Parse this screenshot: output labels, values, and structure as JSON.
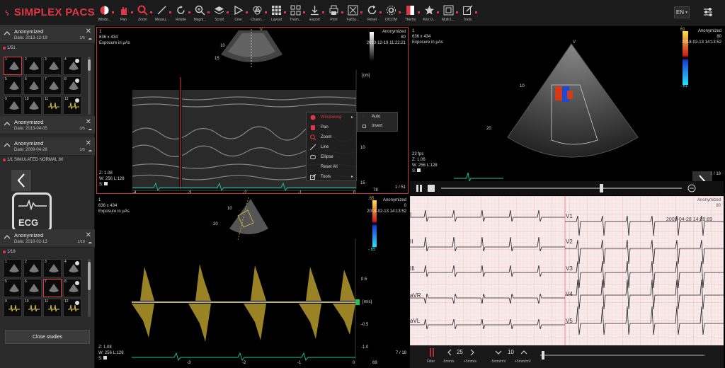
{
  "app": {
    "brand": "SIMPLEX PACS",
    "language": "EN"
  },
  "toolbar": [
    {
      "label": "Windo...",
      "icon": "windowing-icon"
    },
    {
      "label": "Pan",
      "icon": "pan-icon"
    },
    {
      "label": "Zoom",
      "icon": "zoom-icon"
    },
    {
      "label": "Measu...",
      "icon": "measure-icon"
    },
    {
      "label": "Rotate",
      "icon": "rotate-icon"
    },
    {
      "label": "Magni...",
      "icon": "magnifier-icon"
    },
    {
      "label": "Scroll",
      "icon": "scroll-icon"
    },
    {
      "label": "Cine",
      "icon": "cine-icon"
    },
    {
      "label": "Chann...",
      "icon": "channel-icon"
    },
    {
      "label": "Layout",
      "icon": "layout-icon"
    },
    {
      "label": "Thum...",
      "icon": "thumbnails-icon"
    },
    {
      "label": "Export",
      "icon": "export-icon"
    },
    {
      "label": "Print",
      "icon": "print-icon"
    },
    {
      "label": "FullSc...",
      "icon": "fullscreen-icon"
    },
    {
      "label": "Reset",
      "icon": "reset-icon"
    },
    {
      "label": "DICOM",
      "icon": "dicom-icon"
    },
    {
      "label": "Theme",
      "icon": "theme-icon"
    },
    {
      "label": "Key O...",
      "icon": "star-icon"
    },
    {
      "label": "Multi L...",
      "icon": "multi-layout-icon"
    },
    {
      "label": "Tools",
      "icon": "tools-icon"
    }
  ],
  "sidebar": {
    "studies": [
      {
        "name": "Anonymized",
        "date": "Date: 2013-12-19",
        "count": "1/5",
        "series": "1/51"
      },
      {
        "name": "Anonymized",
        "date": "Date: 2013-04-05",
        "count": "3/5"
      },
      {
        "name": "Anonymized",
        "date": "Date: 2009-04-28",
        "count": "1/5",
        "series": "1/1   SIMULATED NORMAL 80"
      },
      {
        "name": "Anonymized",
        "date": "Date: 2018-02-13",
        "count": "1/18",
        "series": "1/18"
      }
    ],
    "thumbs_a": [
      "1",
      "2",
      "3",
      "4",
      "5",
      "6",
      "7",
      "8",
      "9",
      "10",
      "11",
      "12"
    ],
    "thumbs_b": [
      "1",
      "2",
      "3",
      "4",
      "5",
      "6",
      "7",
      "8",
      "9",
      "10",
      "11",
      "12"
    ],
    "ecg_badge": "ECG",
    "close_button": "Close studies"
  },
  "vp1": {
    "tl": [
      "1",
      "636 x 434",
      "Exposure in µAs"
    ],
    "tr": [
      "Anonymized",
      "80",
      "2013-12-19 11:22:21"
    ],
    "bl": [
      "Z: 1.08",
      "W: 256 L:128",
      "S:"
    ],
    "frame": "1 / 51",
    "unit": "[cm]",
    "scale": [
      "5",
      "10",
      "15"
    ],
    "scale_top": [
      "10",
      "15"
    ],
    "time_ticks": [
      "-4",
      "-3",
      "-2",
      "-1",
      "0"
    ],
    "bottom_val": "78",
    "heading": "V"
  },
  "menu": {
    "items": [
      {
        "label": "Windowing",
        "icon": "windowing-icon",
        "active": true,
        "arrow": "▸"
      },
      {
        "label": "Pan",
        "icon": "pan-icon"
      },
      {
        "label": "Zoom",
        "icon": "zoom-icon"
      },
      {
        "label": "Line",
        "icon": "line-icon"
      },
      {
        "label": "Ellipse",
        "icon": "ellipse-icon"
      },
      {
        "label": "Reset All",
        "icon": ""
      },
      {
        "label": "Tools",
        "icon": "tools-icon",
        "arrow": "▸"
      }
    ],
    "submenu": [
      {
        "label": "Auto",
        "checked": false
      },
      {
        "label": "Invert",
        "checked": false
      }
    ]
  },
  "vp2": {
    "tl": [
      "1",
      "636 x 434",
      "Exposure in µAs"
    ],
    "tr": [
      "Anonymized",
      "80",
      "2018-02-13 14:13:52"
    ],
    "bl": [
      "23 fps",
      "Z: 1.06",
      "W: 256 L:128",
      "S:"
    ],
    "scale_top": "61",
    "scale_bot": "-.61",
    "depth": [
      "10",
      "20"
    ],
    "heading": "V",
    "frame": "1 / 18"
  },
  "vp3": {
    "tl": [
      "1",
      "636 x 434",
      "Exposure in µAs"
    ],
    "tr": [
      "Anonymized",
      "0",
      "2018-02-13 14:13:52"
    ],
    "bl": [
      "Z: 1.08",
      "W: 256 L:128",
      "S:"
    ],
    "scale_top": ".65",
    "scale_bot": "-.65",
    "depth": [
      "10",
      "20"
    ],
    "unit": "[m/s]",
    "vel_ticks": [
      "0.5",
      "-0.5",
      "-1.0"
    ],
    "time_ticks": [
      "-3",
      "-2",
      "-1",
      "0"
    ],
    "bottom_val": "69",
    "frame": "7 / 18"
  },
  "vp4": {
    "tr": [
      "Anonymized",
      "80"
    ],
    "timestamp": "2009-04-28 14:39:89",
    "leads_left": [
      "I",
      "II",
      "III",
      "aVR",
      "aVL"
    ],
    "leads_right": [
      "V1",
      "V2",
      "V3",
      "V4",
      "V5"
    ],
    "controls": {
      "filter": "Filter",
      "speed_val": "25",
      "speed_minus": "-5mm/s",
      "speed_plus": "+5mm/s",
      "gain_val": "10",
      "gain_minus": "-5mm/mV",
      "gain_plus": "+5mm/mV"
    }
  },
  "colors": {
    "accent": "#e03645",
    "doppler": "#d9c24a",
    "ecg_grid": "#e8b4b4"
  }
}
